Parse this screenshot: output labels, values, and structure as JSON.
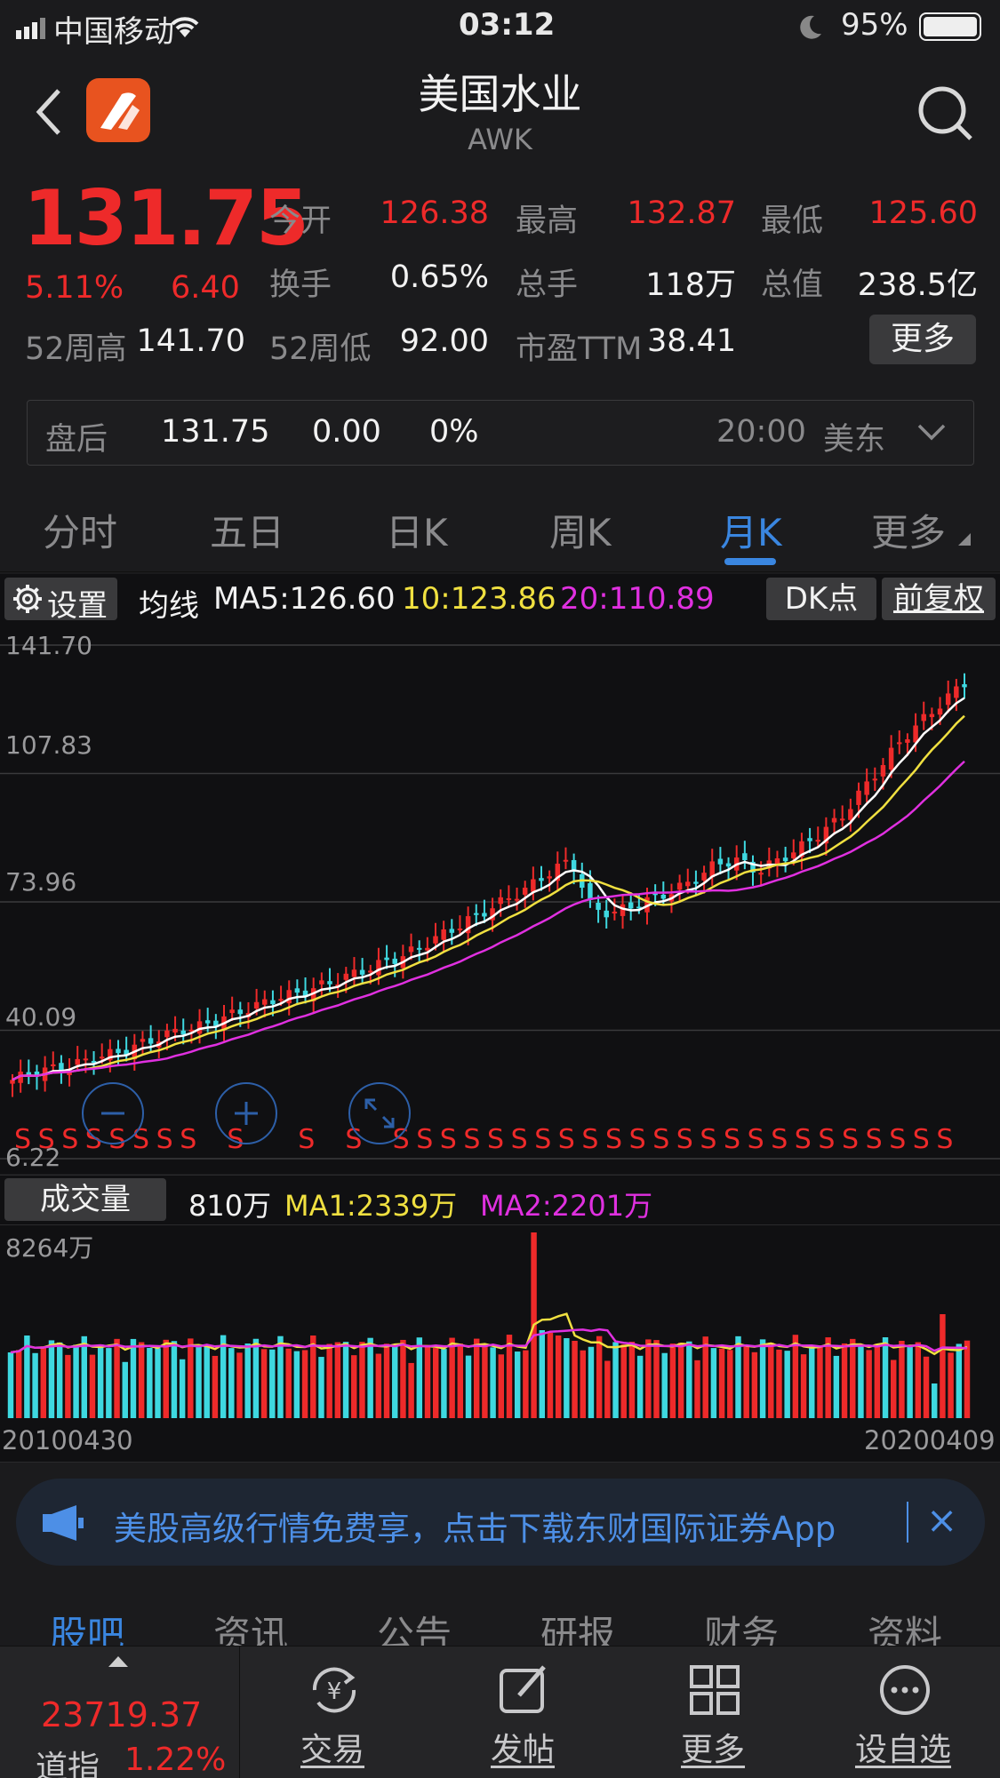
{
  "status_bar": {
    "carrier": "中国移动",
    "time": "03:12",
    "battery": "95%"
  },
  "header": {
    "title": "美国水业",
    "ticker": "AWK"
  },
  "quote": {
    "price": "131.75",
    "change_pct": "5.11%",
    "change": "6.40",
    "open_label": "今开",
    "open": "126.38",
    "high_label": "最高",
    "high": "132.87",
    "low_label": "最低",
    "low": "125.60",
    "turnover_label": "换手",
    "turnover": "0.65%",
    "volume_label": "总手",
    "volume": "118万",
    "mcap_label": "总值",
    "mcap": "238.5亿",
    "wk52_high_label": "52周高",
    "wk52_high": "141.70",
    "wk52_low_label": "52周低",
    "wk52_low": "92.00",
    "pe_label": "市盈TTM",
    "pe": "38.41",
    "more_label": "更多"
  },
  "after_hours": {
    "label": "盘后",
    "price": "131.75",
    "change": "0.00",
    "pct": "0%",
    "time": "20:00",
    "zone": "美东"
  },
  "tabs": [
    "分时",
    "五日",
    "日K",
    "周K",
    "月K",
    "更多"
  ],
  "active_tab": "月K",
  "ma_bar": {
    "settings_label": "设置",
    "ma_label": "均线",
    "ma5": "MA5:126.60",
    "ma10": "10:123.86",
    "ma20": "20:110.89",
    "dk_label": "DK点",
    "adjust_label": "前复权"
  },
  "chart_data": [
    {
      "type": "candlestick",
      "y_ticks": [
        "141.70",
        "107.83",
        "73.96",
        "40.09",
        "6.22"
      ],
      "ylim": [
        6.22,
        141.7
      ],
      "x_range": [
        "20100430",
        "20200409"
      ],
      "series": [
        {
          "name": "MA5",
          "color": "#ffffff",
          "last": 126.6
        },
        {
          "name": "MA10",
          "color": "#f0e040",
          "last": 123.86
        },
        {
          "name": "MA20",
          "color": "#e030e0",
          "last": 110.89
        }
      ],
      "close_values": [
        27,
        29,
        30,
        31,
        33,
        34,
        36,
        38,
        40,
        41,
        43,
        45,
        47,
        49,
        50,
        52,
        54,
        56,
        58,
        60,
        63,
        66,
        69,
        72,
        75,
        78,
        82,
        85,
        72,
        71,
        73,
        75,
        77,
        80,
        84,
        85,
        82,
        85,
        88,
        92,
        96,
        103,
        110,
        117,
        122,
        127,
        131.75
      ]
    },
    {
      "type": "bar",
      "title": "成交量",
      "y_ticks": [
        "8264万"
      ],
      "series": [
        {
          "name": "MA1",
          "color": "#f0e040",
          "last_label": "MA1:2339万"
        },
        {
          "name": "MA2",
          "color": "#e030e0",
          "last_label": "MA2:2201万"
        }
      ]
    }
  ],
  "volume_bar": {
    "label": "成交量",
    "current": "810万",
    "ma1": "MA1:2339万",
    "ma2": "MA2:2201万",
    "ymax": "8264万"
  },
  "dates": {
    "start": "20100430",
    "end": "20200409"
  },
  "ad": {
    "text": "美股高级行情免费享，点击下载东财国际证券App",
    "close": "×"
  },
  "bottom_tabs": [
    "股吧",
    "资讯",
    "公告",
    "研报",
    "财务",
    "资料"
  ],
  "footer": {
    "index_value": "23719.37",
    "index_name": "道指",
    "index_pct": "1.22%",
    "actions": [
      "交易",
      "发帖",
      "更多",
      "设自选"
    ]
  },
  "colors": {
    "up": "#ee2a2a",
    "down": "#3ed8e0",
    "accent": "#3a86e0"
  }
}
